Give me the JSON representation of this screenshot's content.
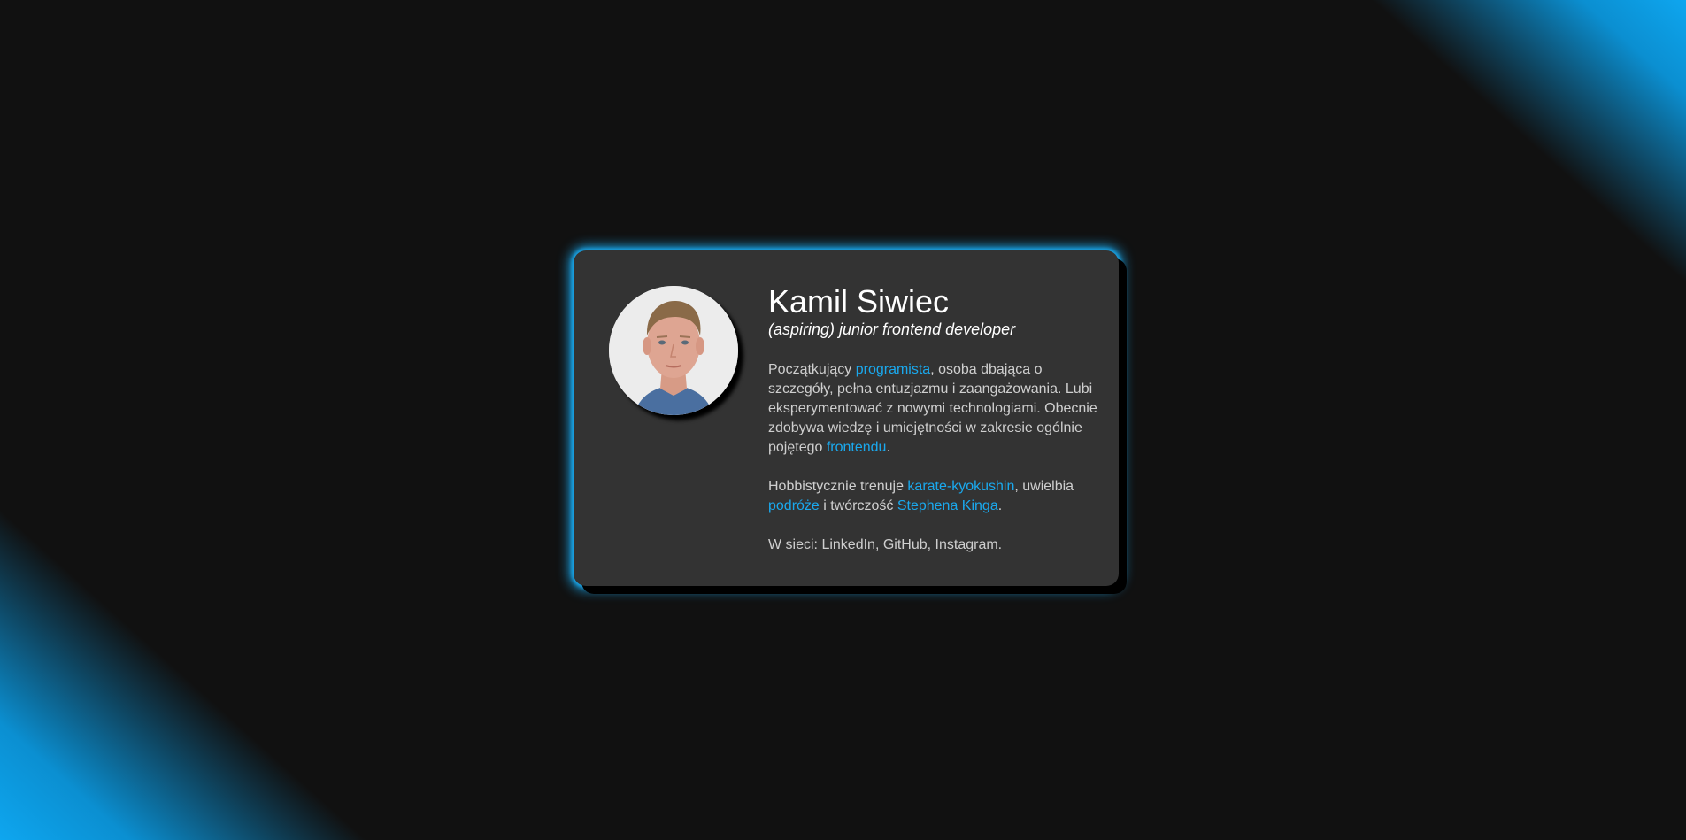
{
  "profile": {
    "name": "Kamil Siwiec",
    "role": "(aspiring) junior frontend developer"
  },
  "about": {
    "p1_a": "Początkujący ",
    "p1_link1": "programista",
    "p1_b": ", osoba dbająca o szczegóły, pełna entuzjazmu i zaangażowania. Lubi eksperymentować z nowymi technologiami. Obecnie zdobywa wiedzę i umiejętności w zakresie ogólnie pojętego ",
    "p1_link2": "frontendu",
    "p1_c": ".",
    "p2_a": "Hobbistycznie trenuje ",
    "p2_link1": "karate-kyokushin",
    "p2_b": ", uwielbia ",
    "p2_link2": "podróże",
    "p2_c": " i twórczość ",
    "p2_link3": "Stephena Kinga",
    "p2_d": ".",
    "p3_a": "W sieci: ",
    "p3_link1": "LinkedIn",
    "p3_sep1": ", ",
    "p3_link2": "GitHub",
    "p3_sep2": ", ",
    "p3_link3": "Instagram",
    "p3_end": "."
  },
  "colors": {
    "accent": "#1aa9ee",
    "background": "#111111",
    "card": "#333333"
  },
  "icons": {
    "avatar": "profile-photo"
  }
}
